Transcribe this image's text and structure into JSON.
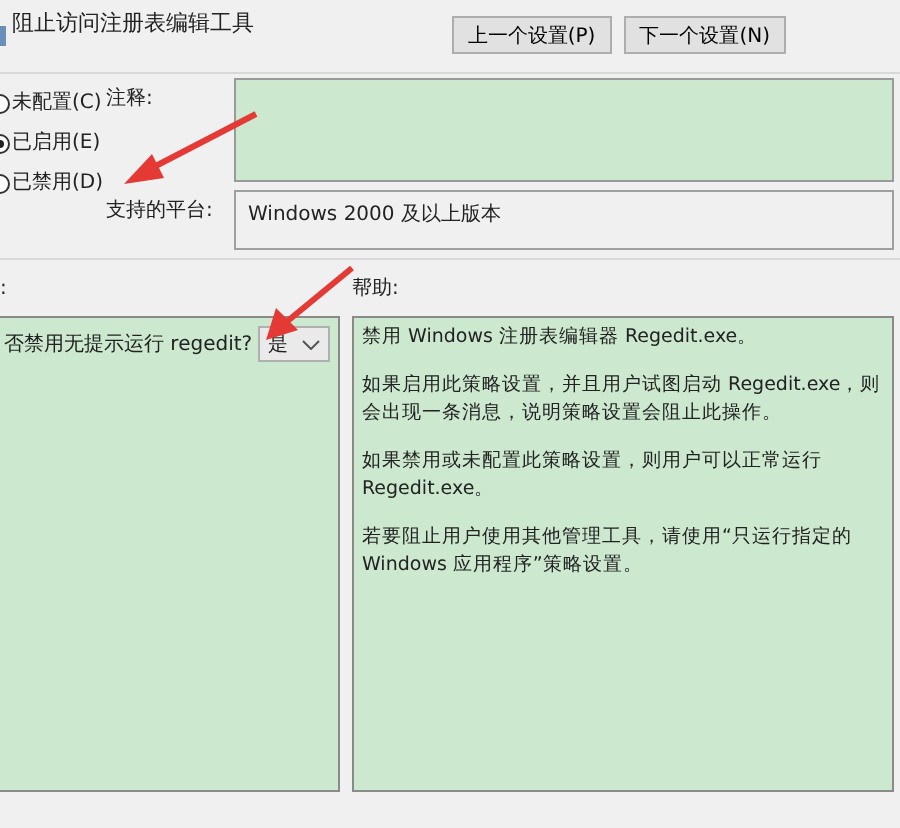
{
  "window": {
    "title": "阻止访问注册表编辑工具"
  },
  "nav_buttons": [
    {
      "label": "上一个设置(P)"
    },
    {
      "label": "下一个设置(N)"
    }
  ],
  "radios": [
    {
      "label": "未配置(C)",
      "selected": false
    },
    {
      "label": "已启用(E)",
      "selected": true
    },
    {
      "label": "已禁用(D)",
      "selected": false
    }
  ],
  "comment": {
    "label": "注释:"
  },
  "platform": {
    "label": "支持的平台:",
    "value": "Windows 2000 及以上版本"
  },
  "options": {
    "label": ":",
    "prompt": "否禁用无提示运行 regedit?",
    "dropdown": "是"
  },
  "help": {
    "label": "帮助:",
    "paragraphs": [
      "禁用 Windows 注册表编辑器 Regedit.exe。",
      "如果启用此策略设置，并且用户试图启动 Regedit.exe，则会出现一条消息，说明策略设置会阻止此操作。",
      "如果禁用或未配置此策略设置，则用户可以正常运行 Regedit.exe。",
      "若要阻止用户使用其他管理工具，请使用“只运行指定的 Windows 应用程序”策略设置。"
    ]
  }
}
